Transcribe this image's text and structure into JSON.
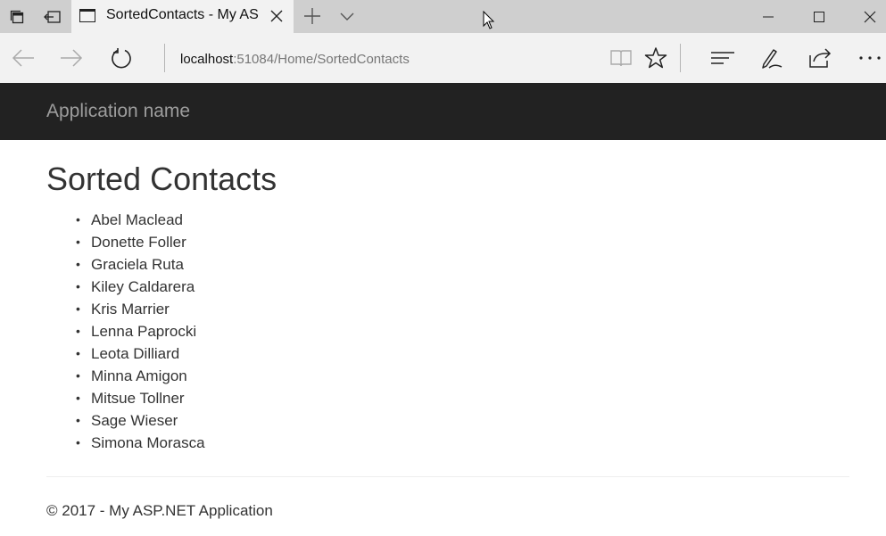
{
  "browser": {
    "tab": {
      "title": "SortedContacts - My ASP.NET Application"
    },
    "address": {
      "host": "localhost",
      "rest": ":51084/Home/SortedContacts"
    },
    "icons": {
      "tab_manager": "tabs-icon",
      "set_aside": "set-aside-tabs-icon",
      "page": "page-icon",
      "close_tab": "close-icon",
      "new_tab": "plus-icon",
      "tab_list": "chevron-down-icon",
      "back": "back-arrow-icon",
      "forward": "forward-arrow-icon",
      "refresh": "refresh-icon",
      "reading_view": "book-icon",
      "favorite": "star-icon",
      "hub": "hub-icon",
      "notes": "pen-icon",
      "share": "share-icon",
      "more": "more-icon",
      "minimize": "minimize-icon",
      "maximize": "maximize-icon",
      "close_window": "close-icon"
    }
  },
  "app": {
    "brand": "Application name",
    "page_title": "Sorted Contacts",
    "contacts": [
      "Abel Maclead",
      "Donette Foller",
      "Graciela Ruta",
      "Kiley Caldarera",
      "Kris Marrier",
      "Lenna Paprocki",
      "Leota Dilliard",
      "Minna Amigon",
      "Mitsue Tollner",
      "Sage Wieser",
      "Simona Morasca"
    ],
    "footer": "© 2017 - My ASP.NET Application"
  },
  "colors": {
    "header_bg": "#222222",
    "brand_text": "#9d9d9d",
    "tab_strip": "#cfcfcf",
    "chrome": "#f2f2f2"
  }
}
